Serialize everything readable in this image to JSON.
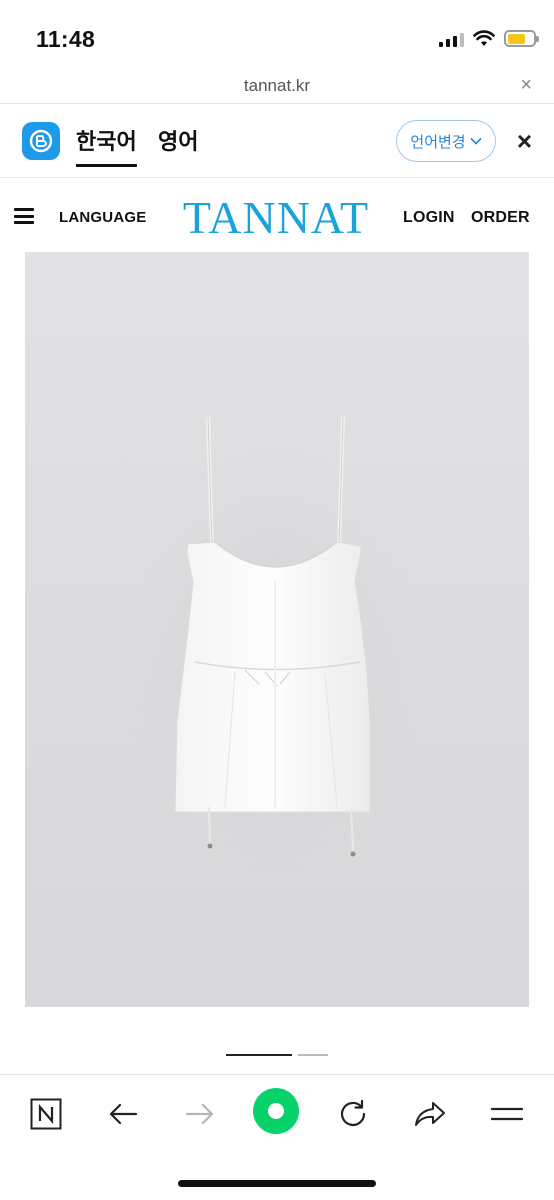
{
  "status_bar": {
    "time": "11:48",
    "battery_color": "#f5c518"
  },
  "browser": {
    "url": "tannat.kr",
    "close_symbol": "×"
  },
  "translate_bar": {
    "source_lang": "한국어",
    "target_lang": "영어",
    "change_label": "언어변경",
    "close_symbol": "×",
    "icon": "papago-icon"
  },
  "site_header": {
    "language_label": "LANGUAGE",
    "logo": "TANNAT",
    "login_label": "LOGIN",
    "order_label": "ORDER",
    "brand_color": "#19a3d9"
  },
  "product_image": {
    "alt": "white sleeveless mini dress"
  },
  "carousel": {
    "total": 2,
    "active": 1
  },
  "toolbar": {
    "items": [
      "naver-n-icon",
      "back-arrow-icon",
      "forward-arrow-icon",
      "green-dot-icon",
      "refresh-icon",
      "share-icon",
      "menu-icon"
    ],
    "accent": "#07d36a"
  }
}
